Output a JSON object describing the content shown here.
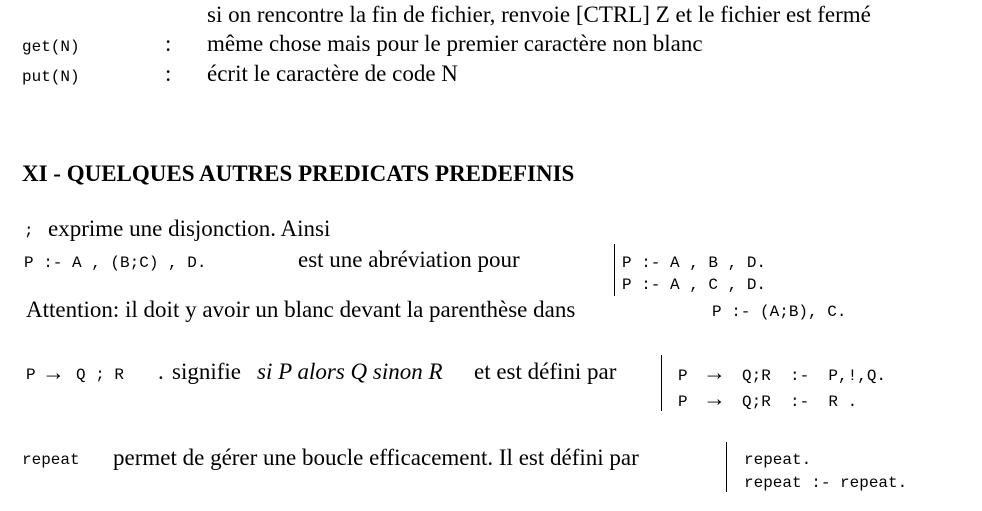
{
  "top": {
    "continuation_text": "si on rencontre la fin de fichier, renvoie [CTRL] Z et le fichier est fermé",
    "get": {
      "code": "get(N)",
      "sep": ":",
      "desc": "même chose mais pour le premier caractère non blanc"
    },
    "put": {
      "code": "put(N)",
      "sep": ":",
      "desc": "écrit le caractère de code N"
    }
  },
  "section": {
    "title": "XI - QUELQUES AUTRES PREDICATS PREDEFINIS"
  },
  "disjunction": {
    "symbol": ";",
    "intro": "exprime une disjonction. Ainsi",
    "example_code": "P :- A , (B;C) , D.",
    "abbrev_text": "est une abréviation pour",
    "expansion": [
      "P :- A , B , D.",
      "P :- A , C , D."
    ],
    "attention_text": "Attention: il doit y avoir un blanc devant la parenthèse dans",
    "attention_code": "P :- (A;B), C."
  },
  "ifthenelse": {
    "code_p": "P",
    "arrow": "→",
    "code_rest": "Q ; R",
    "dot": ".",
    "signifie": "signifie",
    "meaning_italic": "si P alors Q sinon R",
    "defined_text": "et est défini par",
    "definition": [
      {
        "head": "P",
        "arrow": "→",
        "rest": "Q;R  :-  P,!,Q."
      },
      {
        "head": "P",
        "arrow": "→",
        "rest": "Q;R  :-  R ."
      }
    ]
  },
  "repeat": {
    "code": "repeat",
    "desc": "permet de gérer une boucle efficacement. Il est défini par",
    "definition": [
      "repeat.",
      "repeat :- repeat."
    ]
  }
}
